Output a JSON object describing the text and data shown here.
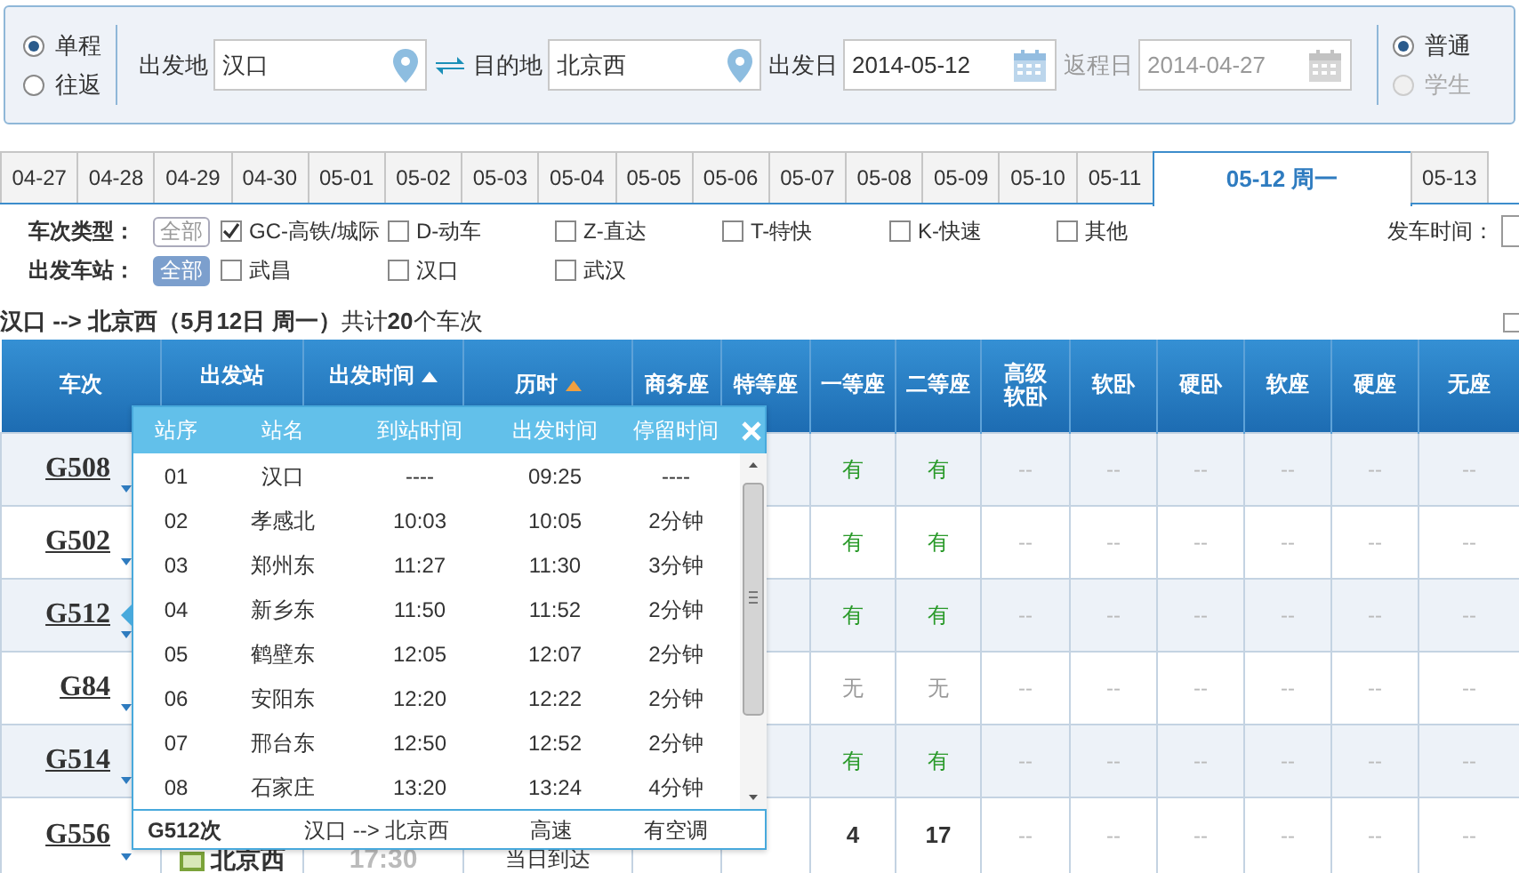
{
  "trip_type": [
    {
      "label": "单程",
      "selected": true
    },
    {
      "label": "往返",
      "selected": false
    }
  ],
  "from": {
    "label": "出发地",
    "value": "汉口"
  },
  "to": {
    "label": "目的地",
    "value": "北京西"
  },
  "depart_date": {
    "label": "出发日",
    "value": "2014-05-12"
  },
  "return_date": {
    "label": "返程日",
    "value": "2014-04-27",
    "disabled": true
  },
  "passenger_type": [
    {
      "label": "普通",
      "selected": true,
      "disabled": false
    },
    {
      "label": "学生",
      "selected": false,
      "disabled": true
    }
  ],
  "date_tabs": [
    {
      "label": "04-27",
      "selected": false
    },
    {
      "label": "04-28",
      "selected": false
    },
    {
      "label": "04-29",
      "selected": false
    },
    {
      "label": "04-30",
      "selected": false
    },
    {
      "label": "05-01",
      "selected": false
    },
    {
      "label": "05-02",
      "selected": false
    },
    {
      "label": "05-03",
      "selected": false
    },
    {
      "label": "05-04",
      "selected": false
    },
    {
      "label": "05-05",
      "selected": false
    },
    {
      "label": "05-06",
      "selected": false
    },
    {
      "label": "05-07",
      "selected": false
    },
    {
      "label": "05-08",
      "selected": false
    },
    {
      "label": "05-09",
      "selected": false
    },
    {
      "label": "05-10",
      "selected": false
    },
    {
      "label": "05-11",
      "selected": false
    },
    {
      "label": "05-12 周一",
      "selected": true
    },
    {
      "label": "05-13",
      "selected": false
    }
  ],
  "filters": [
    {
      "label": "车次类型：",
      "all": {
        "label": "全部",
        "selected": false
      },
      "options": [
        {
          "label": "GC-高铁/城际",
          "checked": true
        },
        {
          "label": "D-动车",
          "checked": false
        },
        {
          "label": "Z-直达",
          "checked": false
        },
        {
          "label": "T-特快",
          "checked": false
        },
        {
          "label": "K-快速",
          "checked": false
        },
        {
          "label": "其他",
          "checked": false
        }
      ]
    },
    {
      "label": "出发车站：",
      "all": {
        "label": "全部",
        "selected": true
      },
      "options": [
        {
          "label": "武昌",
          "checked": false
        },
        {
          "label": "汉口",
          "checked": false
        },
        {
          "label": "武汉",
          "checked": false
        }
      ]
    }
  ],
  "time_filter_label": "发车时间：",
  "summary": "**汉口 --> 北京西（5月12日  周一）**共计**20**个车次",
  "table": {
    "columns": [
      {
        "label": "车次"
      },
      {
        "label": "出发站"
      },
      {
        "label": "出发时间",
        "sorted": false
      },
      {
        "label": "历时",
        "sorted": true
      },
      {
        "label": "商务座"
      },
      {
        "label": "特等座"
      },
      {
        "label": "一等座"
      },
      {
        "label": "二等座"
      },
      {
        "label": "高级软卧"
      },
      {
        "label": "软卧"
      },
      {
        "label": "硬卧"
      },
      {
        "label": "软座"
      },
      {
        "label": "硬座"
      },
      {
        "label": "无座"
      }
    ],
    "rows": [
      {
        "train": "G508",
        "seats": [
          {
            "kind": "available",
            "text": "有"
          },
          {
            "kind": "available",
            "text": "有"
          },
          {
            "kind": "none",
            "text": "--"
          },
          {
            "kind": "none",
            "text": "--"
          },
          {
            "kind": "none",
            "text": "--"
          },
          {
            "kind": "none",
            "text": "--"
          },
          {
            "kind": "none",
            "text": "--"
          },
          {
            "kind": "none",
            "text": "--"
          }
        ]
      },
      {
        "train": "G502",
        "seats": [
          {
            "kind": "available",
            "text": "有"
          },
          {
            "kind": "available",
            "text": "有"
          },
          {
            "kind": "none",
            "text": "--"
          },
          {
            "kind": "none",
            "text": "--"
          },
          {
            "kind": "none",
            "text": "--"
          },
          {
            "kind": "none",
            "text": "--"
          },
          {
            "kind": "none",
            "text": "--"
          },
          {
            "kind": "none",
            "text": "--"
          }
        ]
      },
      {
        "train": "G512",
        "seats": [
          {
            "kind": "available",
            "text": "有"
          },
          {
            "kind": "available",
            "text": "有"
          },
          {
            "kind": "none",
            "text": "--"
          },
          {
            "kind": "none",
            "text": "--"
          },
          {
            "kind": "none",
            "text": "--"
          },
          {
            "kind": "none",
            "text": "--"
          },
          {
            "kind": "none",
            "text": "--"
          },
          {
            "kind": "none",
            "text": "--"
          }
        ]
      },
      {
        "train": "G84",
        "seats": [
          {
            "kind": "soldout",
            "text": "无"
          },
          {
            "kind": "soldout",
            "text": "无"
          },
          {
            "kind": "none",
            "text": "--"
          },
          {
            "kind": "none",
            "text": "--"
          },
          {
            "kind": "none",
            "text": "--"
          },
          {
            "kind": "none",
            "text": "--"
          },
          {
            "kind": "none",
            "text": "--"
          },
          {
            "kind": "none",
            "text": "--"
          }
        ]
      },
      {
        "train": "G514",
        "seats": [
          {
            "kind": "available",
            "text": "有"
          },
          {
            "kind": "available",
            "text": "有"
          },
          {
            "kind": "none",
            "text": "--"
          },
          {
            "kind": "none",
            "text": "--"
          },
          {
            "kind": "none",
            "text": "--"
          },
          {
            "kind": "none",
            "text": "--"
          },
          {
            "kind": "none",
            "text": "--"
          },
          {
            "kind": "none",
            "text": "--"
          }
        ]
      },
      {
        "train": "G556",
        "arrival": {
          "station": "北京西",
          "time": "17:30",
          "duration": "当日到达"
        },
        "seats": [
          {
            "kind": "count",
            "text": "4"
          },
          {
            "kind": "count",
            "text": "17"
          },
          {
            "kind": "none",
            "text": "--"
          },
          {
            "kind": "none",
            "text": "--"
          },
          {
            "kind": "none",
            "text": "--"
          },
          {
            "kind": "none",
            "text": "--"
          },
          {
            "kind": "none",
            "text": "--"
          },
          {
            "kind": "none",
            "text": "--"
          }
        ]
      }
    ]
  },
  "stop_popup": {
    "columns": [
      "站序",
      "站名",
      "到站时间",
      "出发时间",
      "停留时间"
    ],
    "stops": [
      {
        "no": "01",
        "station": "汉口",
        "arrive": "----",
        "depart": "09:25",
        "stay": "----"
      },
      {
        "no": "02",
        "station": "孝感北",
        "arrive": "10:03",
        "depart": "10:05",
        "stay": "2分钟"
      },
      {
        "no": "03",
        "station": "郑州东",
        "arrive": "11:27",
        "depart": "11:30",
        "stay": "3分钟"
      },
      {
        "no": "04",
        "station": "新乡东",
        "arrive": "11:50",
        "depart": "11:52",
        "stay": "2分钟"
      },
      {
        "no": "05",
        "station": "鹤壁东",
        "arrive": "12:05",
        "depart": "12:07",
        "stay": "2分钟"
      },
      {
        "no": "06",
        "station": "安阳东",
        "arrive": "12:20",
        "depart": "12:22",
        "stay": "2分钟"
      },
      {
        "no": "07",
        "station": "邢台东",
        "arrive": "12:50",
        "depart": "12:52",
        "stay": "2分钟"
      },
      {
        "no": "08",
        "station": "石家庄",
        "arrive": "13:20",
        "depart": "13:24",
        "stay": "4分钟"
      }
    ],
    "footer": {
      "train": "G512次",
      "route": "汉口 --> 北京西",
      "class": "高速",
      "aircon": "有空调"
    }
  }
}
